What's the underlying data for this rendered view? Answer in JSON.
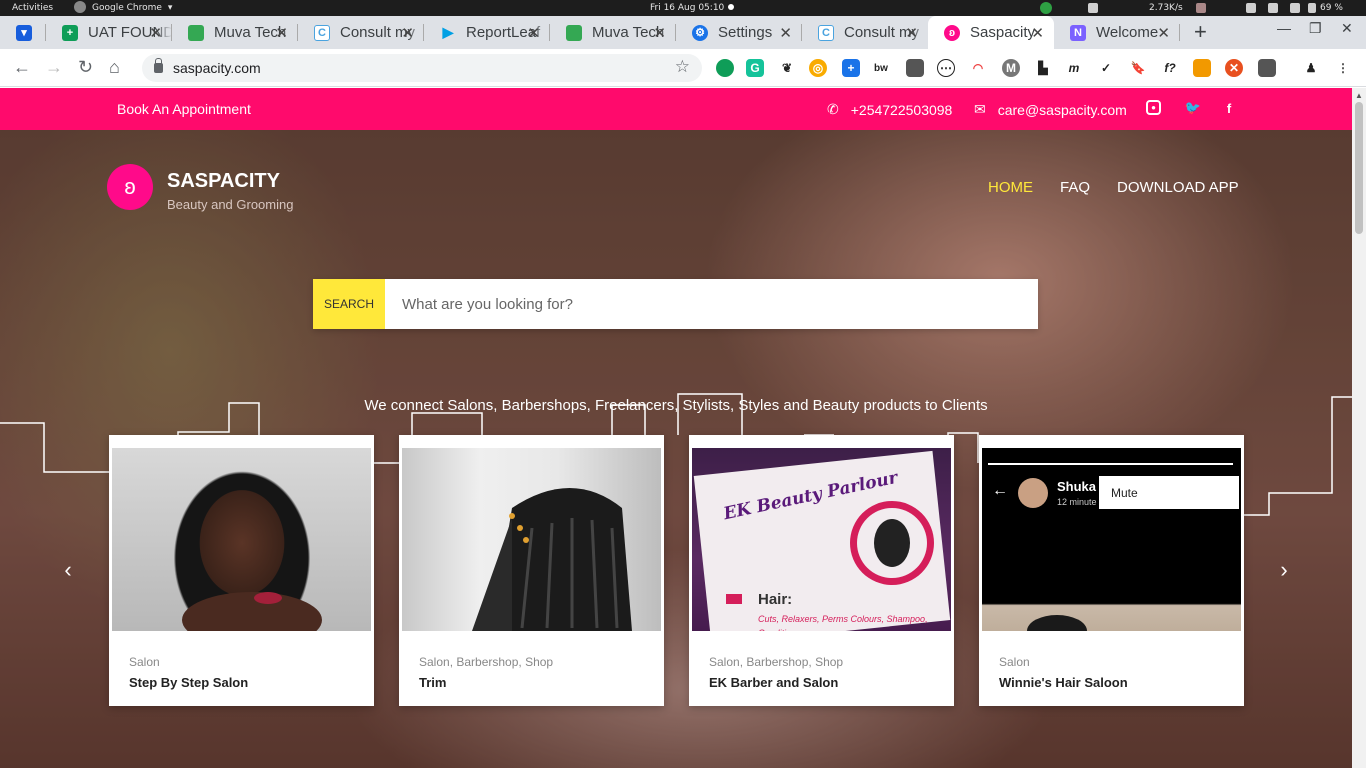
{
  "system": {
    "activities": "Activities",
    "app_name": "Google Chrome",
    "clock": "Fri 16 Aug  05:10",
    "network_speed": "2.73K/s",
    "battery": "69 %"
  },
  "tabs": [
    {
      "title": "",
      "icon": "bitwarden-icon",
      "color": "#175ddc"
    },
    {
      "title": "UAT FOUND",
      "icon": "sheets-icon",
      "color": "#0f9d58"
    },
    {
      "title": "Muva Tech",
      "icon": "maps-icon",
      "color": "#34a853"
    },
    {
      "title": "Consult my",
      "icon": "consult-icon",
      "color": "#4aa3df"
    },
    {
      "title": "ReportLeaf",
      "icon": "play-icon",
      "color": "#00a0e4"
    },
    {
      "title": "Muva Tech",
      "icon": "maps-icon",
      "color": "#34a853"
    },
    {
      "title": "Settings",
      "icon": "gear-icon",
      "color": "#1a73e8"
    },
    {
      "title": "Consult my",
      "icon": "consult-icon",
      "color": "#4aa3df"
    },
    {
      "title": "Saspacity",
      "icon": "saspacity-icon",
      "color": "#ff0a8a"
    },
    {
      "title": "Welcome",
      "icon": "welcome-icon",
      "color": "#7b61ff"
    }
  ],
  "browser": {
    "url": "saspacity.com",
    "new_tab": "+",
    "minimize": "—",
    "maximize": "❐",
    "close": "✕"
  },
  "topbar": {
    "book_label": "Book An Appointment",
    "phone": "+254722503098",
    "email": "care@saspacity.com"
  },
  "brand": {
    "name": "SASPACITY",
    "tagline": "Beauty and Grooming"
  },
  "nav": [
    {
      "label": "HOME",
      "active": true
    },
    {
      "label": "FAQ",
      "active": false
    },
    {
      "label": "DOWNLOAD APP",
      "active": false
    }
  ],
  "search": {
    "button_label": "SEARCH",
    "placeholder": "What are you looking for?"
  },
  "tagline": "We connect Salons, Barbershops, Freelancers, Stylists, Styles and Beauty products to Clients",
  "cards": [
    {
      "category": "Salon",
      "title": "Step By Step Salon"
    },
    {
      "category": "Salon, Barbershop, Shop",
      "title": "Trim"
    },
    {
      "category": "Salon, Barbershop, Shop",
      "title": "EK Barber and Salon",
      "image_text": "EK Beauty Parlour",
      "image_sub": "Hair:",
      "image_list": "Cuts, Relaxers, Perms Colours, Shampoo, Conditions"
    },
    {
      "category": "Salon",
      "title": "Winnie's Hair Saloon",
      "image_name": "Shuka B",
      "image_time": "12 minute",
      "image_menu": "Mute"
    }
  ],
  "colors": {
    "brand_pink": "#ff0a6c",
    "nav_active": "#ffe83a",
    "search_button": "#ffe83a"
  }
}
